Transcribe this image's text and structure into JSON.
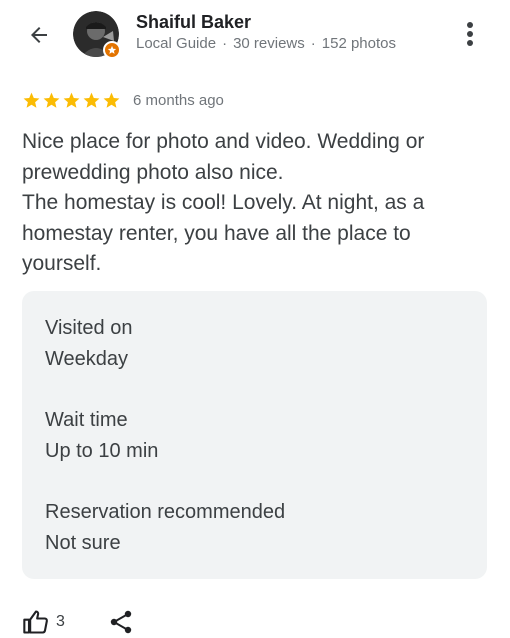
{
  "reviewer": {
    "name": "Shaiful Baker",
    "level": "Local Guide",
    "reviews": "30 reviews",
    "photos": "152 photos",
    "separator": "·"
  },
  "review": {
    "rating": 5,
    "max_rating": 5,
    "time": "6 months ago",
    "text": "Nice place for photo and video. Wedding or prewedding photo also nice.\nThe homestay is cool! Lovely. At night, as a homestay renter, you have all the place to yourself."
  },
  "attributes": [
    {
      "label": "Visited on",
      "value": "Weekday"
    },
    {
      "label": "Wait time",
      "value": "Up to 10 min"
    },
    {
      "label": "Reservation recommended",
      "value": "Not sure"
    }
  ],
  "actions": {
    "like_count": "3"
  },
  "icons": {
    "back": "arrow-back-icon",
    "more": "more-vert-icon",
    "star": "star-icon",
    "badge": "local-guide-star-icon",
    "like": "thumb-up-icon",
    "share": "share-icon"
  },
  "colors": {
    "star": "#fbbc04",
    "badge": "#e37400",
    "card_bg": "#f1f3f4",
    "meta_text": "#70757a"
  }
}
